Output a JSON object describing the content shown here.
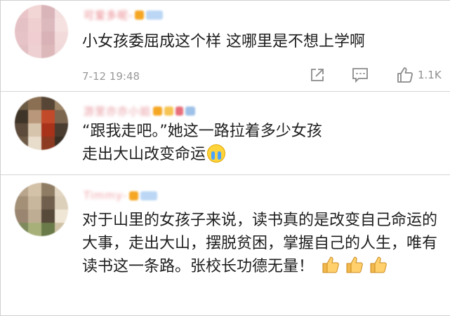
{
  "comments": [
    {
      "username": "可爱多呢-",
      "text": "小女孩委屈成这个样 这哪里是不想上学啊",
      "time": "7-12 19:48",
      "likes": "1.1K",
      "avatar_colors": [
        "#e9c5c9",
        "#f2d5d5",
        "#d9b4b8",
        "#f4dede",
        "#e4c1c4",
        "#f0cfd1",
        "#dbb9bc",
        "#f6e1e1",
        "#e6c3c7",
        "#efcdd0",
        "#d8b2b6",
        "#f3dada",
        "#e2bfc2",
        "#eed0d2",
        "#dcb8bb",
        "#f1d8d9"
      ],
      "name_color": "#e8838a"
    },
    {
      "username": "游里亦亦小姐",
      "text": "“跟我走吧。”她这一路拉着多少女孩走出大山改变命运",
      "avatar_colors": [
        "#6b5a44",
        "#8a6f52",
        "#574636",
        "#9d8466",
        "#3f3428",
        "#b8977a",
        "#c24a2a",
        "#7d6650",
        "#5c4a3a",
        "#d7c4ad",
        "#a8321a",
        "#4a3c2f",
        "#6e5b47",
        "#e8dccb",
        "#8c3a22",
        "#3a2f25"
      ],
      "name_color": "#e89aa0"
    },
    {
      "username": "Timmy-",
      "text": "对于山里的女孩子来说，读书真的是改变自己命运的大事，走出大山，摆脱贫困，掌握自己的人生，唯有读书这一条路。张校长功德无量！",
      "avatar_colors": [
        "#b8a58c",
        "#d3c2a8",
        "#8f7c64",
        "#e2d6c2",
        "#a39077",
        "#c9b79d",
        "#6f5f4c",
        "#ddd0bb",
        "#9a8670",
        "#beac93",
        "#574a3b",
        "#efe6d6",
        "#7e8a5c",
        "#a8b07a",
        "#6a7a48",
        "#cfc2a6"
      ],
      "name_color": "#f0a0a6"
    }
  ],
  "icons": {
    "share": "share-icon",
    "comment": "comment-icon",
    "like": "thumbs-up-icon",
    "cry": "crying-emoji-icon",
    "thumb": "thumbs-up-emoji-icon"
  },
  "colors": {
    "meta": "#9a9a9a",
    "divider": "#d6d6d6",
    "badge_orange": "#f5a623",
    "badge_blue": "#bcd7f5"
  }
}
